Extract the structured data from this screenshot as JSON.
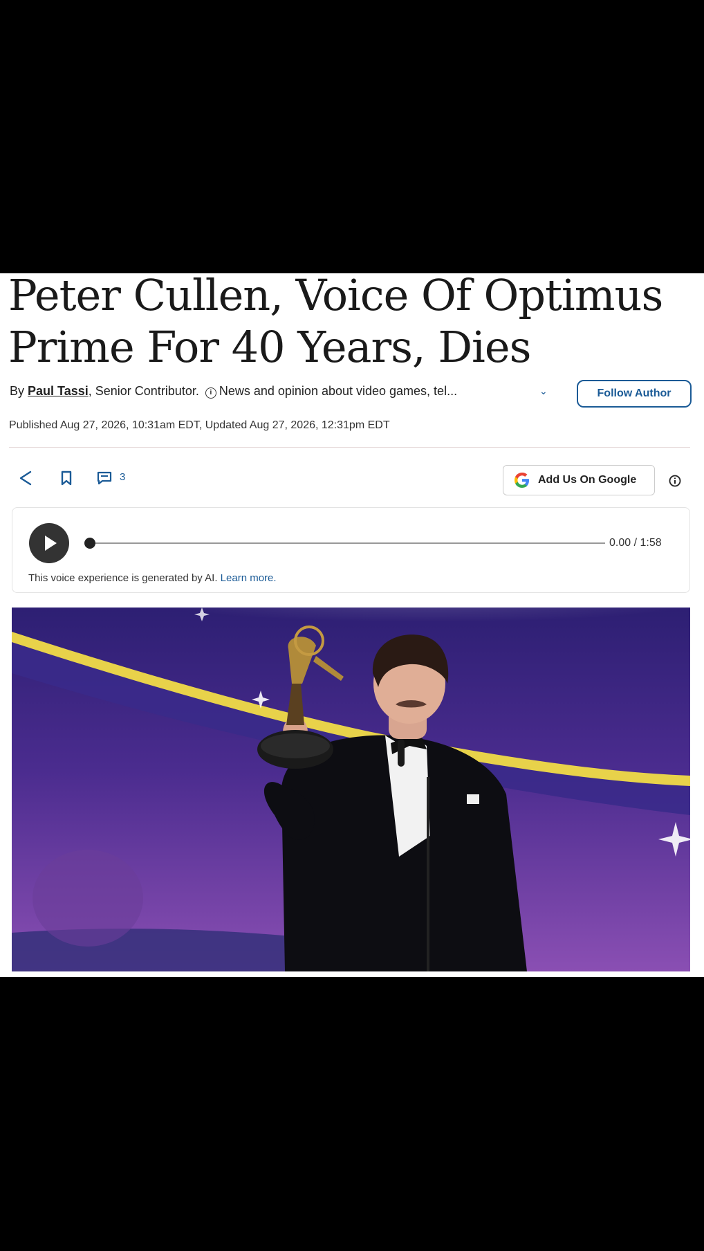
{
  "article": {
    "headline": "Peter Cullen, Voice Of Optimus Prime For 40 Years, Dies",
    "byline": {
      "by": "By",
      "author": "Paul Tassi",
      "role": ", Senior Contributor.",
      "description": "News and opinion about video games, tel...",
      "follow_label": "Follow Author"
    },
    "published": "Published Aug 27, 2026, 10:31am EDT, Updated Aug 27, 2026, 12:31pm EDT",
    "actions": {
      "comment_count": "3",
      "google_label": "Add Us On Google"
    },
    "audio": {
      "time": "0.00 / 1:58",
      "progress": 0,
      "note": "This voice experience is generated by AI.",
      "learn_more": "Learn more."
    }
  },
  "colors": {
    "accent": "#1a5a96",
    "photo_background": "#5b3a9a",
    "photo_stripe": "#e8d24a"
  }
}
